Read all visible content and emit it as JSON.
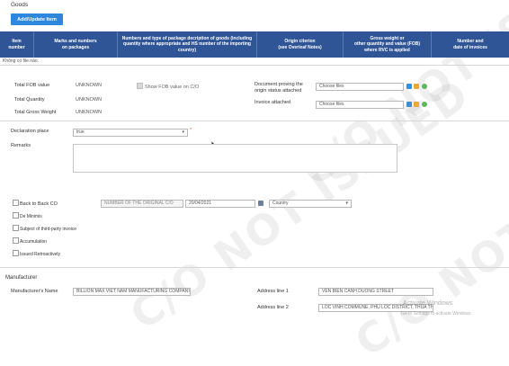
{
  "section_title": "Goods",
  "add_button_label": "Add/Update Item",
  "table": {
    "headers": [
      "Item\nnumber",
      "Marks and numbers\non packages",
      "Numbers and type of package decription of goods (including\nquantity where appropriate and HS number of the importing\ncountry)",
      "Origin citerion\n(see Overleaf Notes)",
      "Gross weight or\nother quantity and value (FOB)\nwhere RVC is applied",
      "Number and\ndate of invoices"
    ],
    "empty_text": "Không có file nào."
  },
  "totals": {
    "fob_label": "Total FOB value",
    "fob_value": "UNKNOWN",
    "quantity_label": "Total Quantity",
    "quantity_value": "UNKNOWN",
    "gross_weight_label": "Total Gross Weight",
    "gross_weight_value": "UNKNOWN",
    "show_fob_label": "Show FOB value on C/O"
  },
  "documents": {
    "proving_label": "Document proving the\norigin status attached",
    "proving_placeholder": "Choose files",
    "invoice_label": "Invoice attached",
    "invoice_placeholder": "Choose files"
  },
  "declaration": {
    "label": "Declaration place",
    "value": "true"
  },
  "remarks_label": "Remarks",
  "options": {
    "back_to_back": "Back to Back CO",
    "original_co_placeholder": "NUMBER OF THE ORIGINAL C/O",
    "date_value": "20/04/2021",
    "country_placeholder": "Country",
    "de_minimis": "De Minimis",
    "third_party": "Subject of third-party invoice",
    "accumulation": "Accumulation",
    "retroactive": "Issued Retroactively"
  },
  "manufacturer": {
    "section_title": "Manufacturer",
    "name_label": "Manufacturer's Name",
    "name_value": "BILLION MAX VIET NAM MANUFACTURING COMPANY",
    "address1_label": "Address line 1",
    "address1_value": "VEN BIEN CANH DUONG STREET",
    "address2_label": "Address line 2",
    "address2_value": "LOC VINH COMMUNE, PHU LOC DISTRICT, THUA THIE"
  },
  "watermark": "C/O NOT ISSUED",
  "os_notice": {
    "title": "Activate Windows",
    "subtitle": "Go to Settings to activate Windows."
  },
  "colors": {
    "header_bg": "#2f5597",
    "button_bg": "#2e86de",
    "required_mark": "#d9534f"
  }
}
